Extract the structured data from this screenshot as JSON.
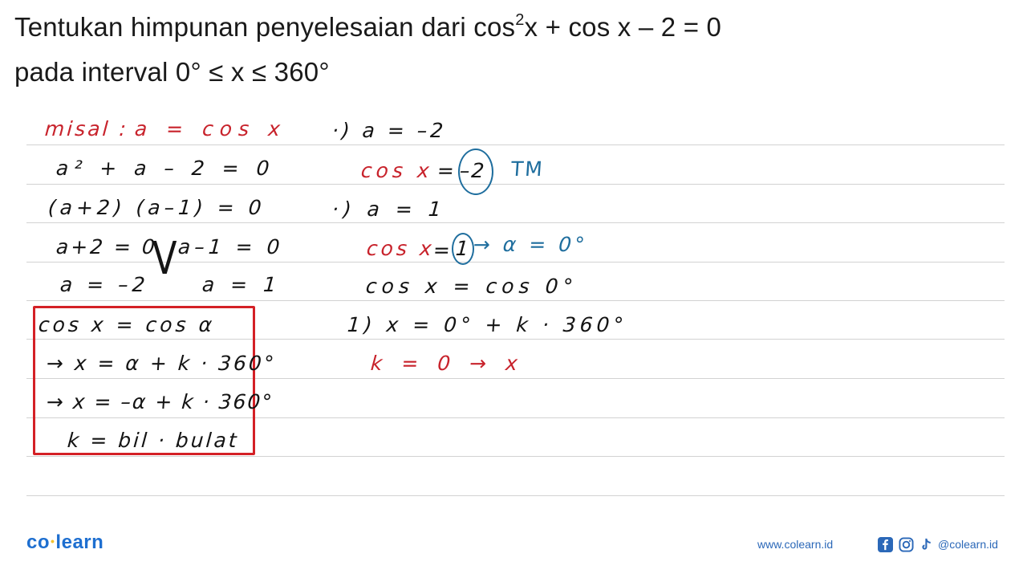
{
  "question": {
    "line1_prefix": "Tentukan himpunan penyelesaian dari cos",
    "line1_sup": "2",
    "line1_suffix": "x + cos x – 2 = 0",
    "line2": "pada interval 0° ≤ x ≤ 360°"
  },
  "left_column": {
    "substitution_label": "misal :",
    "substitution_expr": "a = cos x",
    "steps": [
      "a² + a – 2 = 0",
      "(a+2) (a–1) = 0",
      "a+2 = 0",
      "a–1 = 0",
      "a = –2",
      "a = 1"
    ],
    "or_symbol": "V"
  },
  "boxed_formula": {
    "lines": [
      "cos x  =  cos α",
      "→  x  =  α + k · 360°",
      "→  x  = –α + k · 360°",
      "k  =  bil · bulat"
    ]
  },
  "right_column": {
    "case1_header": "·) a = –2",
    "case1_red": "cos x",
    "case1_eq": "=",
    "case1_circled": "–2",
    "case1_note": "TM",
    "case2_header": "·) a = 1",
    "case2_red": "cos x",
    "case2_eq": "=",
    "case2_circled": "1",
    "case2_arrow_note": "→ α = 0°",
    "case2_line2": "cos x  =  cos 0°",
    "case2_line3": "1) x = 0° + k · 360°",
    "case2_line4": "k = 0 → x"
  },
  "footer": {
    "logo_left": "co",
    "logo_dot": "•",
    "logo_right": "learn",
    "website": "www.colearn.id",
    "social_handle": "@colearn.id",
    "social_icons": [
      "facebook-icon",
      "instagram-icon",
      "tiktok-icon"
    ]
  },
  "colors": {
    "ink": "#141414",
    "red_ink": "#c8232c",
    "blue_ink": "#1f6e9e",
    "box_border": "#d42026",
    "brand_blue": "#1e6fd0"
  }
}
